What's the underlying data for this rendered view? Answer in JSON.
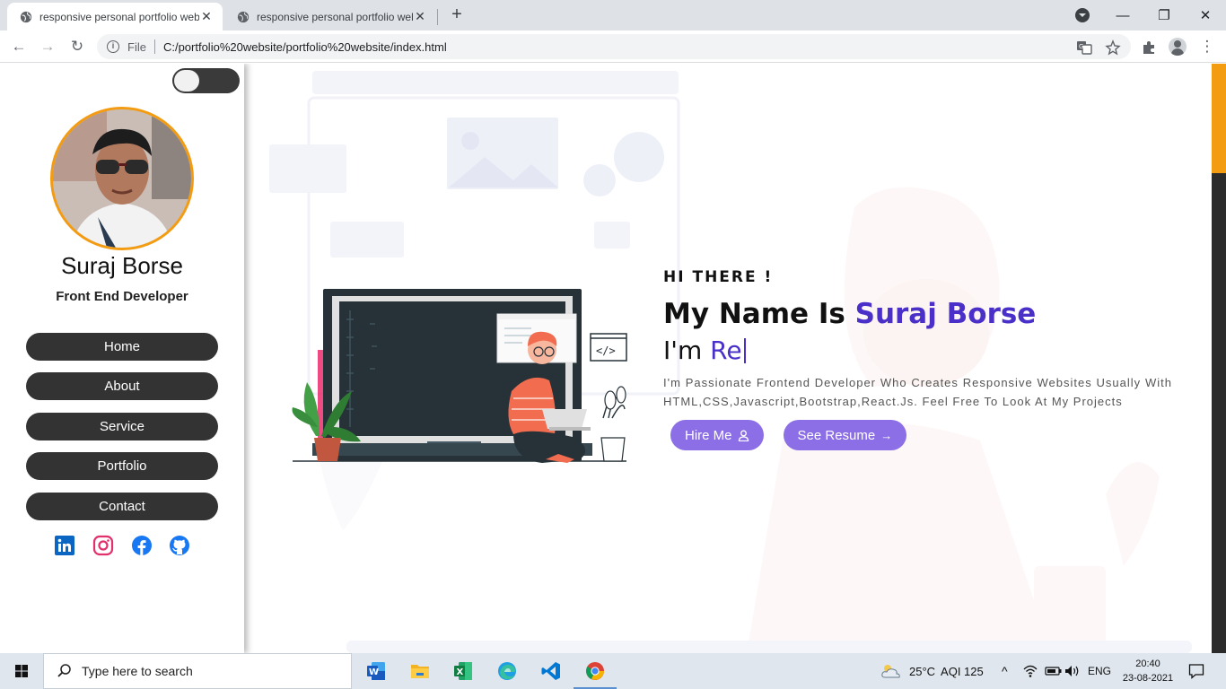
{
  "browser": {
    "tabs": [
      {
        "title": "responsive personal portfolio website",
        "active": true
      },
      {
        "title": "responsive personal portfolio website",
        "active": false
      }
    ],
    "url_scheme": "File",
    "url": "C:/portfolio%20website/portfolio%20website/index.html",
    "close_glyph": "✕",
    "new_tab_glyph": "+",
    "back_glyph": "←",
    "forward_glyph": "→",
    "reload_glyph": "↻",
    "minimize_glyph": "—",
    "maximize_glyph": "❐",
    "window_close_glyph": "✕",
    "menu_glyph": "⋮"
  },
  "sidebar": {
    "name": "Suraj Borse",
    "role": "Front End Developer",
    "nav": [
      "Home",
      "About",
      "Service",
      "Portfolio",
      "Contact"
    ],
    "socials": [
      "linkedin-icon",
      "instagram-icon",
      "facebook-icon",
      "github-icon"
    ],
    "dark_mode_toggle": "off"
  },
  "hero": {
    "greeting": "HI THERE !",
    "name_prefix": "My Name Is",
    "name": "Suraj Borse",
    "typed_prefix": "I'm",
    "typed_text": "Re",
    "description": "I'm Passionate Frontend Developer Who Creates Responsive Websites Usually With HTML,CSS,Javascript,Bootstrap,React.Js. Feel Free To Look At My Projects",
    "hire_button": "Hire Me",
    "resume_button": "See Resume",
    "resume_arrow": "→"
  },
  "colors": {
    "accent": "#4a30c9",
    "button": "#8c6fe6",
    "avatar_border": "#f39c12",
    "nav_bg": "#333333"
  },
  "taskbar": {
    "search_placeholder": "Type here to search",
    "apps": [
      "word-icon",
      "file-explorer-icon",
      "excel-icon",
      "edge-icon",
      "vscode-icon",
      "chrome-icon"
    ],
    "weather": "25°C",
    "aqi": "AQI 125",
    "language": "ENG",
    "time": "20:40",
    "date": "23-08-2021"
  }
}
